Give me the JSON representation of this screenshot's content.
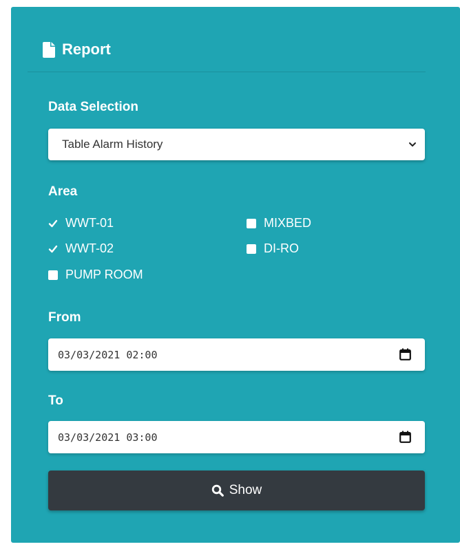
{
  "panel": {
    "title": "Report",
    "title_icon": "file-icon",
    "background_color": "#1fa5b3"
  },
  "data_selection": {
    "label": "Data Selection",
    "selected": "Table Alarm History"
  },
  "area": {
    "label": "Area",
    "options": [
      {
        "label": "WWT-01",
        "checked": true
      },
      {
        "label": "MIXBED",
        "checked": false
      },
      {
        "label": "WWT-02",
        "checked": true
      },
      {
        "label": "DI-RO",
        "checked": false
      },
      {
        "label": "PUMP ROOM",
        "checked": false
      }
    ]
  },
  "from": {
    "label": "From",
    "value": "03/03/2021 02:00"
  },
  "to": {
    "label": "To",
    "value": "03/03/2021 03:00"
  },
  "show_button": {
    "label": "Show",
    "icon": "search-icon",
    "background_color": "#343a40"
  }
}
